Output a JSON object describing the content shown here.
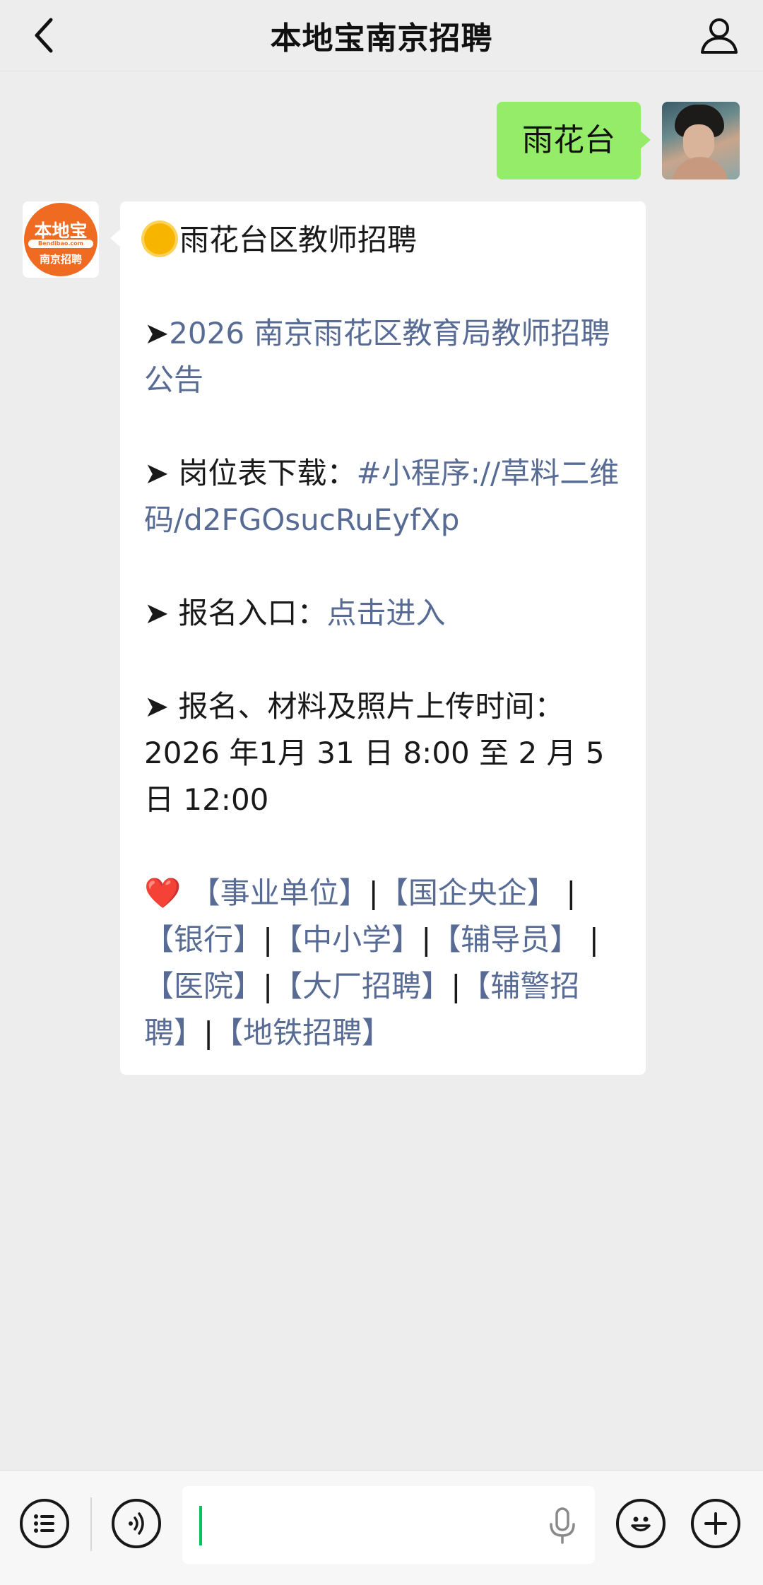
{
  "header": {
    "title": "本地宝南京招聘",
    "back_icon": "chevron-left-icon",
    "profile_icon": "user-icon"
  },
  "messages": {
    "me": {
      "text": "雨花台",
      "bubble_color": "#95ec69"
    },
    "account": {
      "avatar": {
        "top": "本地宝",
        "band": "Bendibao.com",
        "bottom": "南京招聘",
        "color": "#ef6b22"
      },
      "heading": "雨花台区教师招聘",
      "item1_prefix": "➤",
      "item1_link": "2026 南京雨花区教育局教师招聘公告",
      "item2_prefix": "➤ 岗位表下载：",
      "item2_link": "#小程序://草料二维码/d2FGOsucRuEyfXp",
      "item3_prefix": "➤ 报名入口：",
      "item3_link": "点击进入",
      "item4": "➤ 报名、材料及照片上传时间：2026 年1月 31 日 8:00 至 2 月 5 日 12:00",
      "heart": "❤️",
      "tags": [
        "【事业单位】",
        "【国企央企】",
        "【银行】",
        "【中小学】",
        "【辅导员】",
        "【医院】",
        "【大厂招聘】",
        "【辅警招聘】",
        "【地铁招聘】"
      ],
      "link_color": "#576b95"
    }
  },
  "input_bar": {
    "menu_icon": "list-icon",
    "voice_icon": "voice-icon",
    "mic_icon": "microphone-icon",
    "emoji_icon": "smiley-icon",
    "plus_icon": "plus-icon",
    "value": ""
  }
}
